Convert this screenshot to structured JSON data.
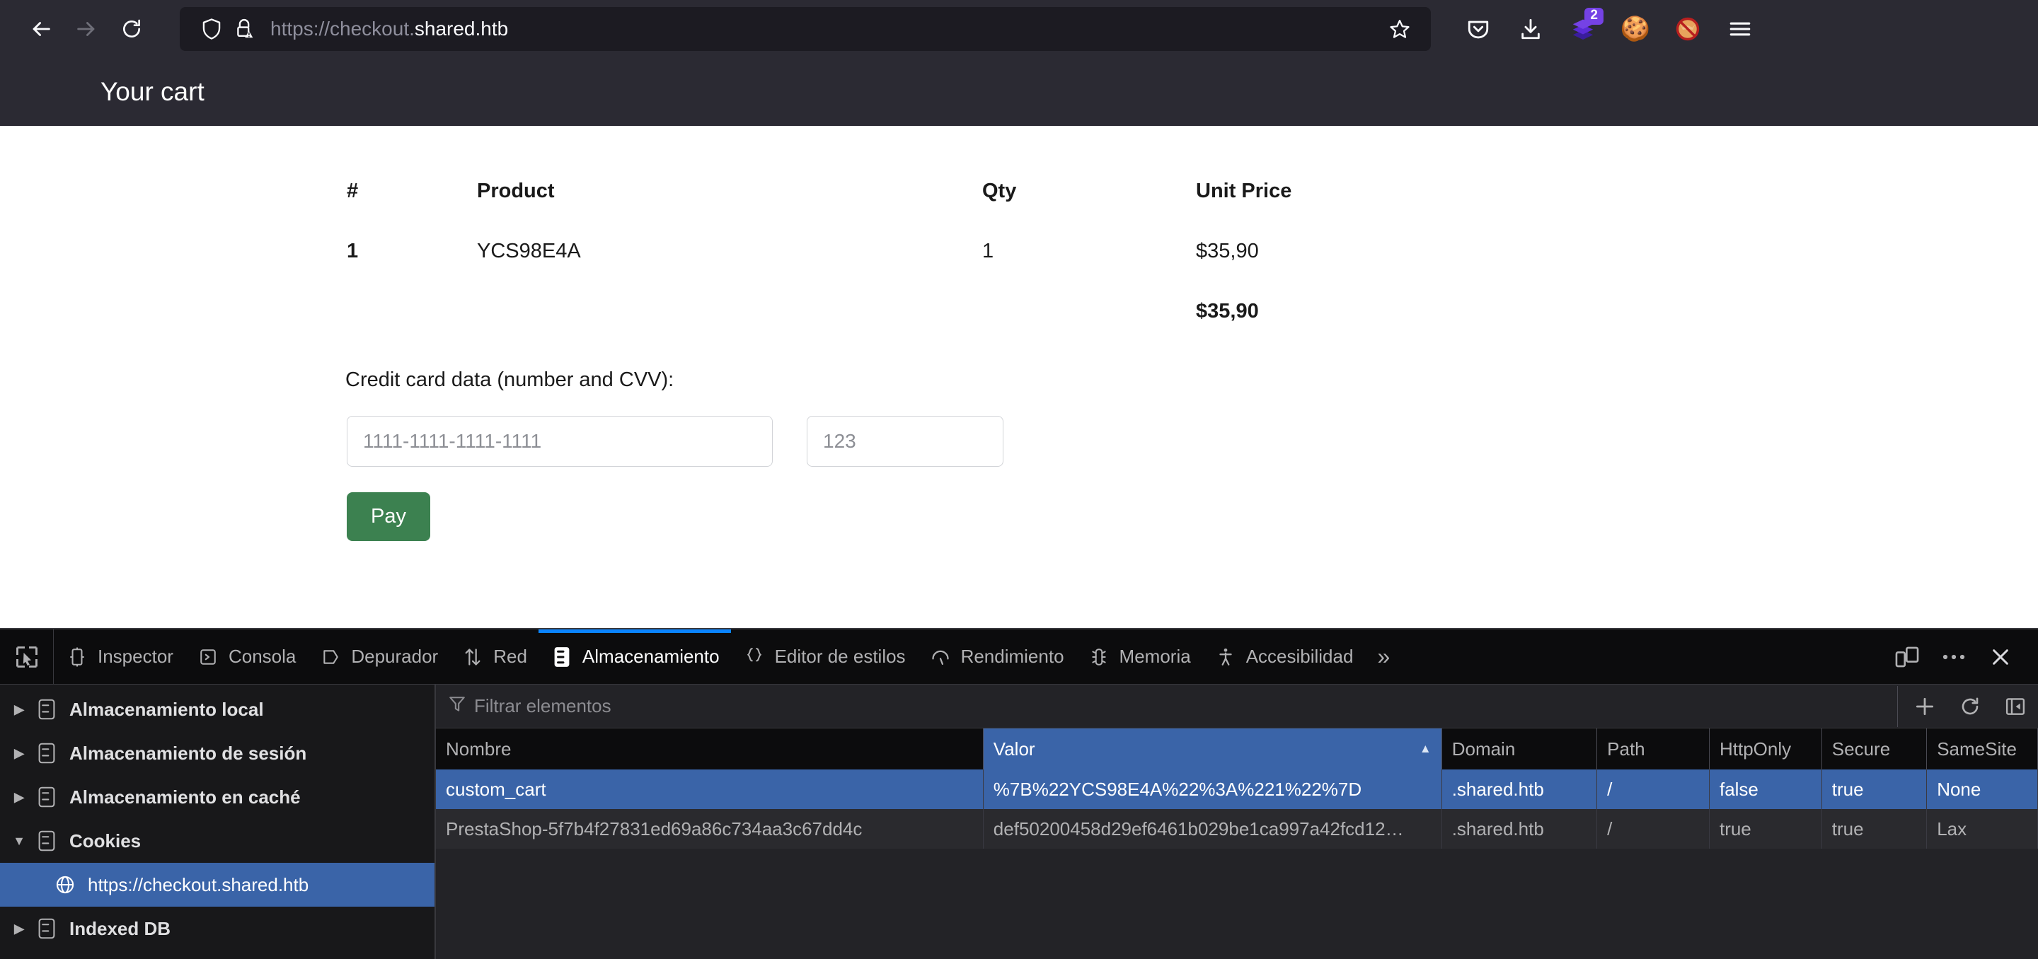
{
  "browser": {
    "nav": {
      "back_icon": "arrow-left-icon",
      "forward_icon": "arrow-right-icon",
      "reload_icon": "reload-icon"
    },
    "urlbar": {
      "shield_icon": "shield-icon",
      "lock_warning_icon": "lock-warning-icon",
      "url_prefix": "https://checkout.",
      "url_host": "shared.htb",
      "full_url": "https://checkout.shared.htb",
      "bookmark_icon": "star-icon"
    },
    "toolbar_right": [
      {
        "name": "pocket-icon",
        "label": "Pocket"
      },
      {
        "name": "download-icon",
        "label": "Downloads"
      },
      {
        "name": "extensions-layers-icon",
        "label": "Extensions",
        "badge": "2"
      },
      {
        "name": "cookie-icon",
        "label": "Cookie Editor",
        "glyph": "🍪"
      },
      {
        "name": "blocked-fox-icon",
        "label": "Blocked Fox",
        "glyph": "🦊"
      },
      {
        "name": "hamburger-menu-icon",
        "label": "Application Menu"
      }
    ]
  },
  "page": {
    "title": "Your cart",
    "cart": {
      "columns": [
        "#",
        "Product",
        "Qty",
        "Unit Price"
      ],
      "rows": [
        {
          "index": "1",
          "product": "YCS98E4A",
          "qty": "1",
          "price": "$35,90"
        }
      ],
      "total": "$35,90"
    },
    "form": {
      "label": "Credit card data (number and CVV):",
      "card_number_value": "",
      "card_number_placeholder": "1111-1111-1111-1111",
      "cvv_value": "",
      "cvv_placeholder": "123",
      "pay_label": "Pay"
    }
  },
  "devtools": {
    "picker_icon": "element-picker-icon",
    "tabs": [
      {
        "label": "Inspector",
        "icon": "inspector-icon",
        "active": false
      },
      {
        "label": "Consola",
        "icon": "console-icon",
        "active": false
      },
      {
        "label": "Depurador",
        "icon": "debugger-icon",
        "active": false
      },
      {
        "label": "Red",
        "icon": "network-icon",
        "active": false
      },
      {
        "label": "Almacenamiento",
        "icon": "storage-icon",
        "active": true
      },
      {
        "label": "Editor de estilos",
        "icon": "style-editor-icon",
        "active": false
      },
      {
        "label": "Rendimiento",
        "icon": "performance-icon",
        "active": false
      },
      {
        "label": "Memoria",
        "icon": "memory-icon",
        "active": false
      },
      {
        "label": "Accesibilidad",
        "icon": "accessibility-icon",
        "active": false
      }
    ],
    "overflow_label": "»",
    "toolbar_right": [
      {
        "name": "responsive-design-mode-icon"
      },
      {
        "name": "meatball-menu-icon"
      },
      {
        "name": "close-devtools-icon"
      }
    ],
    "sidebar": [
      {
        "label": "Almacenamiento local",
        "expanded": false,
        "selected": false,
        "child": false
      },
      {
        "label": "Almacenamiento de sesión",
        "expanded": false,
        "selected": false,
        "child": false
      },
      {
        "label": "Almacenamiento en caché",
        "expanded": false,
        "selected": false,
        "child": false
      },
      {
        "label": "Cookies",
        "expanded": true,
        "selected": false,
        "child": false
      },
      {
        "label": "https://checkout.shared.htb",
        "expanded": null,
        "selected": true,
        "child": true
      },
      {
        "label": "Indexed DB",
        "expanded": false,
        "selected": false,
        "child": false
      }
    ],
    "filter": {
      "icon": "filter-icon",
      "value": "",
      "placeholder": "Filtrar elementos"
    },
    "filter_actions": [
      {
        "name": "add-item-icon"
      },
      {
        "name": "refresh-icon"
      },
      {
        "name": "toggle-sidebar-icon"
      }
    ],
    "table": {
      "columns": [
        {
          "key": "nombre",
          "label": "Nombre",
          "sorted": false
        },
        {
          "key": "valor",
          "label": "Valor",
          "sorted": true,
          "direction": "asc"
        },
        {
          "key": "domain",
          "label": "Domain",
          "sorted": false
        },
        {
          "key": "path",
          "label": "Path",
          "sorted": false
        },
        {
          "key": "httponly",
          "label": "HttpOnly",
          "sorted": false
        },
        {
          "key": "secure",
          "label": "Secure",
          "sorted": false
        },
        {
          "key": "samesite",
          "label": "SameSite",
          "sorted": false
        }
      ],
      "rows": [
        {
          "nombre": "custom_cart",
          "valor": "%7B%22YCS98E4A%22%3A%221%22%7D",
          "domain": ".shared.htb",
          "path": "/",
          "httponly": "false",
          "secure": "true",
          "samesite": "None",
          "selected": true
        },
        {
          "nombre": "PrestaShop-5f7b4f27831ed69a86c734aa3c67dd4c",
          "valor": "def50200458d29ef6461b029be1ca997a42fcd12…",
          "domain": ".shared.htb",
          "path": "/",
          "httponly": "true",
          "secure": "true",
          "samesite": "Lax",
          "selected": false
        }
      ]
    }
  },
  "colors": {
    "chrome_bg": "#2b2a33",
    "urlbar_bg": "#1c1b22",
    "devtools_bg": "#0c0c0d",
    "devtools_panel_bg": "#232327",
    "sidebar_bg": "#18181a",
    "accent_blue": "#0a84ff",
    "selection_blue": "#3a64a8",
    "pay_green": "#3c8150",
    "badge_purple": "#7542e5"
  }
}
